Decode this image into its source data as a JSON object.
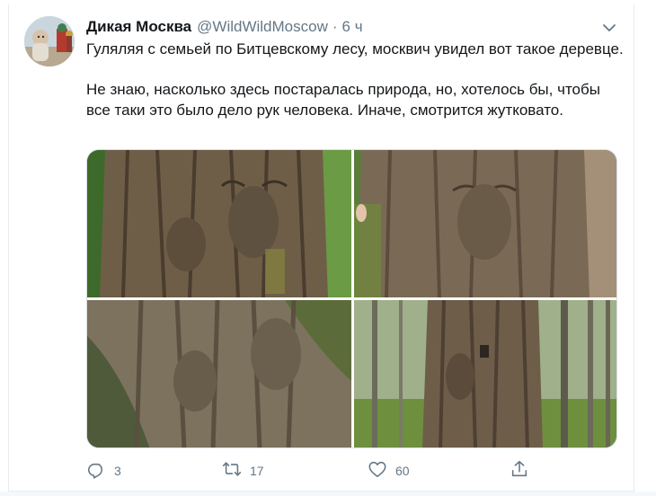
{
  "tweet": {
    "author_name": "Дикая Москва",
    "author_handle": "@WildWildMoscow",
    "separator": "·",
    "time": "6 ч",
    "text": "Гуляляя с семьей по Битцевскому лесу, москвич увидел вот такое деревце.\n\nНе знаю, насколько здесь постаралась природа, но, хотелось бы, чтобы все таки это было дело рук человека. Иначе, смотрится жутковато.",
    "replies": "3",
    "retweets": "17",
    "likes": "60"
  },
  "icons": {
    "menu": "chevron-down-icon",
    "reply": "reply-icon",
    "retweet": "retweet-icon",
    "like": "heart-icon",
    "share": "share-icon"
  },
  "colors": {
    "text": "#14171a",
    "secondary": "#657786",
    "border": "#e6ecf0"
  }
}
